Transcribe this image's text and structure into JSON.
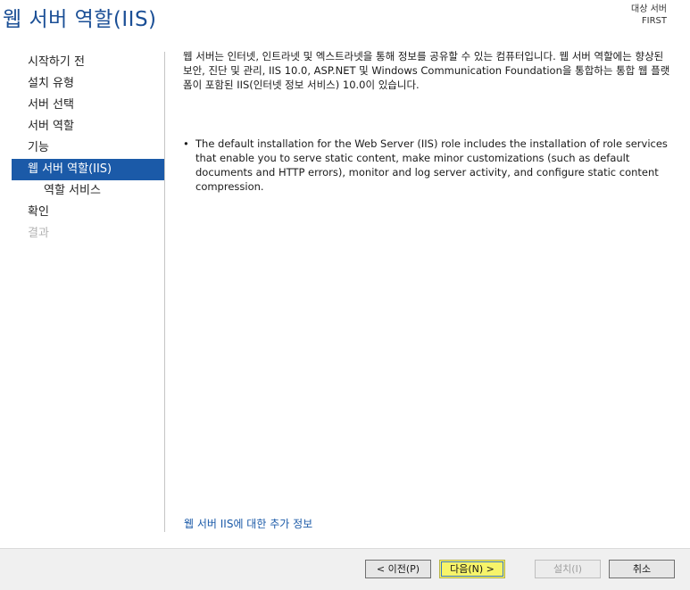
{
  "header": {
    "title": "웹 서버 역할(IIS)",
    "destination_label": "대상 서버",
    "destination_server": "FIRST"
  },
  "sidebar": {
    "items": [
      {
        "label": "시작하기 전",
        "state": "normal"
      },
      {
        "label": "설치 유형",
        "state": "normal"
      },
      {
        "label": "서버 선택",
        "state": "normal"
      },
      {
        "label": "서버 역할",
        "state": "normal"
      },
      {
        "label": "기능",
        "state": "normal"
      },
      {
        "label": "웹 서버 역할(IIS)",
        "state": "active"
      },
      {
        "label": "역할 서비스",
        "state": "sub"
      },
      {
        "label": "확인",
        "state": "normal"
      },
      {
        "label": "결과",
        "state": "disabled"
      }
    ]
  },
  "main": {
    "description": "웹 서버는 인터넷, 인트라넷 및 엑스트라넷을 통해 정보를 공유할 수 있는 컴퓨터입니다. 웹 서버 역할에는 향상된 보안, 진단 및 관리, IIS 10.0, ASP.NET 및 Windows Communication Foundation을 통합하는 통합 웹 플랫폼이 포함된 IIS(인터넷 정보 서비스) 10.0이 있습니다.",
    "bullet_symbol": "•",
    "bullet": "The default installation for the Web Server (IIS) role includes the installation of role services that enable you to serve static content, make minor customizations (such as default documents and HTTP errors), monitor and log server activity, and configure static content compression.",
    "more_info_link": "웹 서버 IIS에 대한 추가 정보"
  },
  "footer": {
    "prev_label": "< 이전(P)",
    "next_label": "다음(N) >",
    "install_label": "설치(I)",
    "cancel_label": "취소"
  },
  "colors": {
    "title": "#1b4f96",
    "nav_active_bg": "#1b5aa8",
    "link": "#1b5aa8",
    "next_highlight": "#f7f46a"
  }
}
